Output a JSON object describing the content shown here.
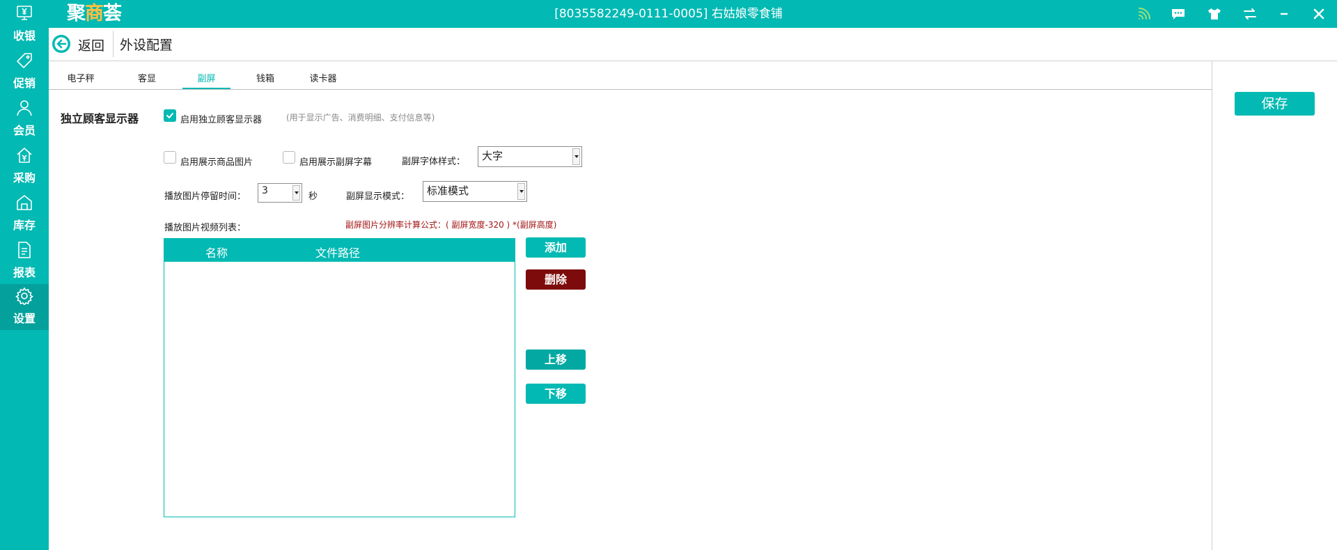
{
  "app": {
    "logo": {
      "part1": "聚",
      "part2": "商",
      "part3": "荟"
    },
    "store_info": "[8035582249-0111-0005] 右姑娘零食铺",
    "colors": {
      "primary": "#02b9b3",
      "danger": "#7e0b0b",
      "accent": "#ffbf3f"
    },
    "toolbar_icons": [
      "wifi-icon",
      "message-icon",
      "shirt-icon",
      "switch-icon",
      "minimize-icon",
      "close-icon"
    ]
  },
  "sidebar": {
    "items": [
      {
        "label": "收银",
        "icon": "cashier-icon"
      },
      {
        "label": "促销",
        "icon": "tag-icon"
      },
      {
        "label": "会员",
        "icon": "member-icon"
      },
      {
        "label": "采购",
        "icon": "purchase-icon"
      },
      {
        "label": "库存",
        "icon": "inventory-icon"
      },
      {
        "label": "报表",
        "icon": "report-icon"
      },
      {
        "label": "设置",
        "icon": "settings-icon"
      }
    ],
    "active": "设置"
  },
  "header": {
    "back_label": "返回",
    "title": "外设配置"
  },
  "tabs": {
    "items": [
      {
        "label": "电子秤"
      },
      {
        "label": "客显"
      },
      {
        "label": "副屏"
      },
      {
        "label": "钱箱"
      },
      {
        "label": "读卡器"
      }
    ],
    "active": "副屏"
  },
  "actions": {
    "save_label": "保存"
  },
  "form": {
    "section_title": "独立顾客显示器",
    "enable_display": {
      "label": "启用独立顾客显示器",
      "checked": true
    },
    "enable_hint": "(用于显示广告、消费明细、支付信息等)",
    "show_product_image": {
      "label": "启用展示商品图片",
      "checked": false
    },
    "show_subtitle": {
      "label": "启用展示副屏字幕",
      "checked": false
    },
    "font_style": {
      "label": "副屏字体样式：",
      "value": "大字"
    },
    "dwell_time": {
      "label": "播放图片停留时间：",
      "value": "3",
      "unit": "秒"
    },
    "display_mode": {
      "label": "副屏显示模式：",
      "value": "标准模式"
    },
    "list_label": "播放图片视频列表：",
    "formula": "副屏图片分辨率计算公式：( 副屏宽度-320 ) *(副屏高度)",
    "table": {
      "columns": [
        "名称",
        "文件路径"
      ],
      "rows": []
    },
    "buttons": {
      "add": "添加",
      "delete": "删除",
      "move_up": "上移",
      "move_down": "下移"
    }
  }
}
